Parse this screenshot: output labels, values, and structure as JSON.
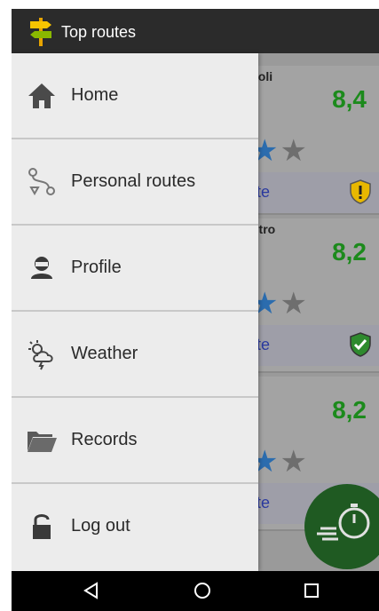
{
  "appbar": {
    "title": "Top routes",
    "logo_icon": "signpost-icon",
    "menu_icon": "hamburger-icon"
  },
  "drawer": {
    "items": [
      {
        "label": "Home",
        "icon": "home-icon"
      },
      {
        "label": "Personal routes",
        "icon": "route-icon"
      },
      {
        "label": "Profile",
        "icon": "profile-icon"
      },
      {
        "label": "Weather",
        "icon": "weather-icon"
      },
      {
        "label": "Records",
        "icon": "folder-icon"
      },
      {
        "label": "Log out",
        "icon": "lock-icon"
      }
    ]
  },
  "routes": [
    {
      "name_fragment": "coli",
      "score": "8,4",
      "link_fragment": "te",
      "status": "warning"
    },
    {
      "name_fragment": "ntro",
      "score": "8,2",
      "link_fragment": "te",
      "status": "ok"
    },
    {
      "name_fragment": "",
      "score": "8,2",
      "link_fragment": "te",
      "status": ""
    }
  ],
  "colors": {
    "score": "#1c8a1c",
    "appbar": "#2b2b2b",
    "fab": "#1f5a22",
    "drawer": "#ececec"
  },
  "fab": {
    "icon": "stopwatch-icon"
  },
  "navbar": {
    "back_icon": "back-triangle-icon",
    "home_icon": "home-circle-icon",
    "recents_icon": "recents-square-icon"
  }
}
